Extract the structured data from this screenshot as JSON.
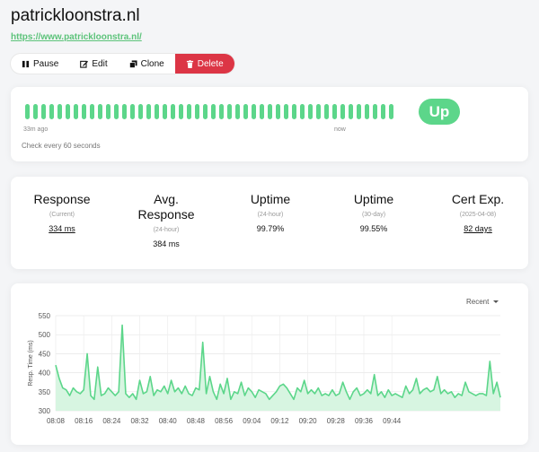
{
  "monitor": {
    "name": "patrickloonstra.nl",
    "url": "https://www.patrickloonstra.nl/"
  },
  "toolbar": {
    "pause_label": "Pause",
    "edit_label": "Edit",
    "clone_label": "Clone",
    "delete_label": "Delete",
    "pause_icon": "pause-icon",
    "edit_icon": "edit-icon",
    "clone_icon": "clone-icon",
    "delete_icon": "trash-icon"
  },
  "heartbeat": {
    "beat_count": 46,
    "beat_color": "#5cd68a",
    "time_start": "33m ago",
    "time_end": "now",
    "interval_text": "Check every 60 seconds",
    "status": "Up"
  },
  "stats": [
    {
      "title": "Response",
      "subtitle": "(Current)",
      "value": "334 ms",
      "underlined": true
    },
    {
      "title": "Avg. Response",
      "subtitle": "(24-hour)",
      "value": "384 ms",
      "underlined": false
    },
    {
      "title": "Uptime",
      "subtitle": "(24-hour)",
      "value": "99.79%",
      "underlined": false
    },
    {
      "title": "Uptime",
      "subtitle": "(30-day)",
      "value": "99.55%",
      "underlined": false
    },
    {
      "title": "Cert Exp.",
      "subtitle": "(2025-04-08)",
      "value": "82 days",
      "underlined": true
    }
  ],
  "chart_controls": {
    "period_label": "Recent"
  },
  "chart_data": {
    "type": "area",
    "ylabel": "Resp. Time (ms)",
    "xlabel": "",
    "ylim": [
      300,
      550
    ],
    "yticks": [
      300,
      350,
      400,
      450,
      500,
      550
    ],
    "grid": true,
    "legend": "none",
    "line_color": "#5cd68a",
    "fill_color": "#d7f5e1",
    "x_start_time": "08:08",
    "x_interval_minutes": 1,
    "xticks": [
      "08:08",
      "08:16",
      "08:24",
      "08:32",
      "08:40",
      "08:48",
      "08:56",
      "09:04",
      "09:12",
      "09:20",
      "09:28",
      "09:36",
      "09:44"
    ],
    "values": [
      420,
      385,
      360,
      355,
      340,
      360,
      350,
      345,
      355,
      450,
      340,
      330,
      415,
      340,
      345,
      360,
      350,
      340,
      350,
      525,
      345,
      335,
      345,
      330,
      380,
      345,
      350,
      390,
      340,
      355,
      350,
      365,
      345,
      380,
      350,
      360,
      345,
      365,
      345,
      340,
      360,
      355,
      480,
      345,
      390,
      350,
      330,
      370,
      345,
      385,
      330,
      350,
      345,
      375,
      340,
      360,
      350,
      335,
      355,
      350,
      345,
      330,
      340,
      350,
      365,
      370,
      360,
      345,
      330,
      360,
      350,
      380,
      345,
      355,
      345,
      360,
      340,
      345,
      340,
      355,
      340,
      345,
      375,
      350,
      330,
      350,
      360,
      340,
      345,
      355,
      345,
      395,
      340,
      350,
      335,
      355,
      340,
      345,
      340,
      335,
      365,
      345,
      355,
      385,
      345,
      355,
      360,
      350,
      355,
      390,
      345,
      355,
      345,
      350,
      335,
      345,
      340,
      375,
      350,
      345,
      340,
      345,
      345,
      340,
      430,
      345,
      375,
      335
    ]
  }
}
